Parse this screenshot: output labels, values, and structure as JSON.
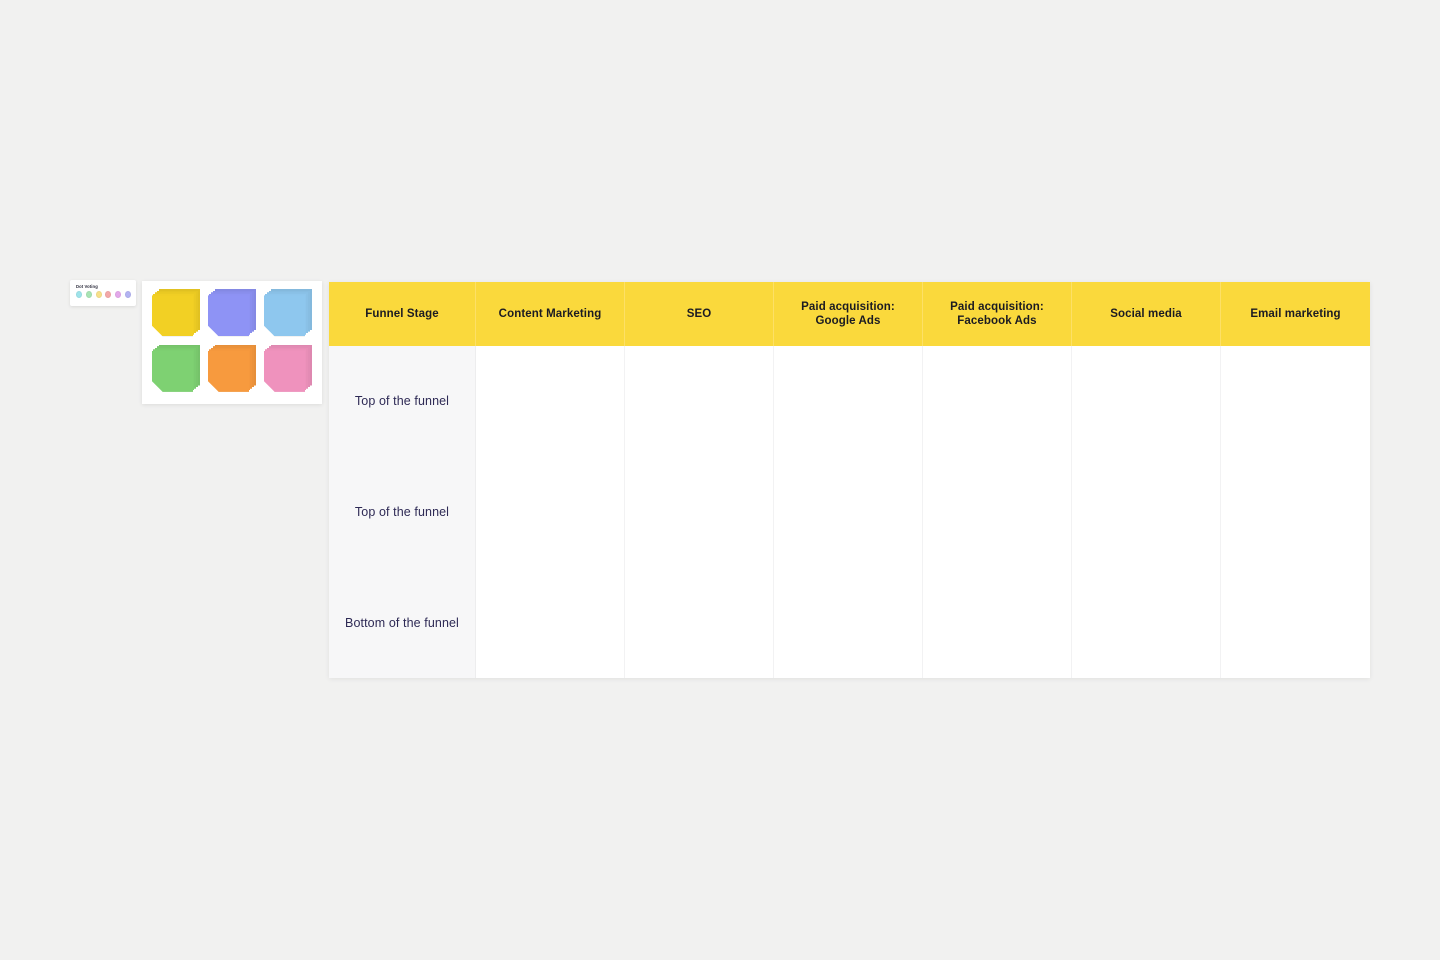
{
  "canvas": {
    "background_color": "#f1f1f0"
  },
  "dot_voting": {
    "title": "Dot Voting",
    "dots": [
      {
        "name": "dot-cyan",
        "color": "#9fe3ea"
      },
      {
        "name": "dot-green",
        "color": "#a8e3b4"
      },
      {
        "name": "dot-yellow",
        "color": "#f7e08a"
      },
      {
        "name": "dot-red",
        "color": "#f3a8a8"
      },
      {
        "name": "dot-magenta",
        "color": "#e3a8ea"
      },
      {
        "name": "dot-violet",
        "color": "#b3b3f2"
      }
    ]
  },
  "sticky_notes": {
    "notes": [
      {
        "name": "sticky-note-yellow",
        "color": "#f2d024"
      },
      {
        "name": "sticky-note-purple",
        "color": "#8e93f5"
      },
      {
        "name": "sticky-note-blue",
        "color": "#8ec7ee"
      },
      {
        "name": "sticky-note-green",
        "color": "#7ed172"
      },
      {
        "name": "sticky-note-orange",
        "color": "#f79a3e"
      },
      {
        "name": "sticky-note-pink",
        "color": "#ef92bd"
      }
    ]
  },
  "table": {
    "header_color": "#fad93c",
    "columns": [
      "Funnel Stage",
      "Content Marketing",
      "SEO",
      "Paid acquisition: Google Ads",
      "Paid acquisition: Facebook Ads",
      "Social media",
      "Email marketing"
    ],
    "rows": [
      {
        "stage": "Top of the funnel",
        "cells": [
          "",
          "",
          "",
          "",
          "",
          ""
        ]
      },
      {
        "stage": "Top of the funnel",
        "cells": [
          "",
          "",
          "",
          "",
          "",
          ""
        ]
      },
      {
        "stage": "Bottom of the funnel",
        "cells": [
          "",
          "",
          "",
          "",
          "",
          ""
        ]
      }
    ]
  }
}
